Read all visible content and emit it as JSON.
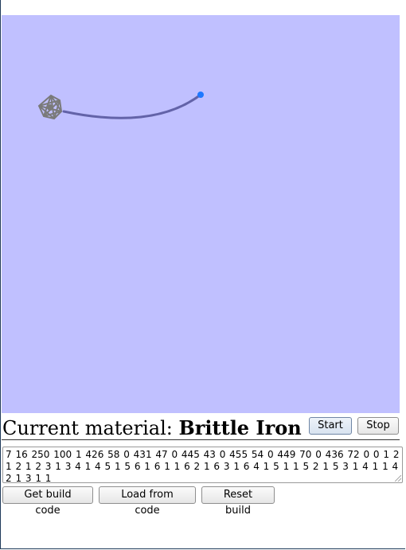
{
  "simulation": {
    "background": "#c0c0ff",
    "node_color": "#1e78ff",
    "beam_color": "#6363a8",
    "hub_color": "#7a7a7a"
  },
  "material": {
    "prefix": "Current material: ",
    "name": "Brittle Iron"
  },
  "controls": {
    "start_label": "Start",
    "stop_label": "Stop"
  },
  "build_code": {
    "value": "7 16 250 100 1 426 58 0 431 47 0 445 43 0 455 54 0 449 70 0 436 72 0 0 1 2 1 2 1 2 3 1 3 4 1 4 5 1 5 6 1 6 1 1 6 2 1 6 3 1 6 4 1 5 1 1 5 2 1 5 3 1 4 1 1 4 2 1 3 1 1"
  },
  "actions": {
    "get_code_label": "Get build code",
    "load_code_label": "Load from code",
    "reset_label": "Reset build"
  }
}
